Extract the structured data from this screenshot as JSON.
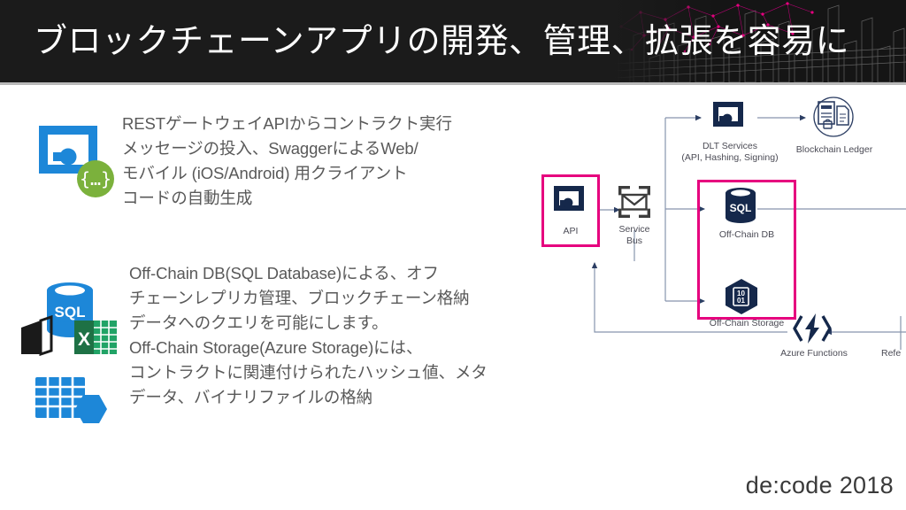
{
  "slide": {
    "title": "ブロックチェーンアプリの開発、管理、拡張を容易に",
    "footer": "de:code 2018",
    "accent_pink": "#e6007e",
    "banner_bg": "#1b1b1b",
    "body_text_color": "#595959",
    "azure_blue": "#0078d4",
    "navy": "#15284b"
  },
  "bullets": [
    {
      "id": "bullet-api",
      "icon_name": "api-apps-json-icon",
      "text": "RESTゲートウェイAPIからコントラクト実行\nメッセージの投入、SwaggerによるWeb/\nモバイル (iOS/Android) 用クライアント\nコードの自動生成"
    },
    {
      "id": "bullet-offchain",
      "icon_name": "sql-database-powerbi-excel-icon",
      "icon_name_2": "azure-table-storage-icon",
      "text": "Off-Chain DB(SQL Database)による、オフ\nチェーンレプリカ管理、ブロックチェーン格納\nデータへのクエリを可能にします。\nOff-Chain Storage(Azure Storage)には、\nコントラクトに関連付けられたハッシュ値、メタ\nデータ、バイナリファイルの格納"
    }
  ],
  "diagram": {
    "nodes": [
      {
        "id": "api",
        "label": "API",
        "icon": "api-apps-icon",
        "highlighted": true
      },
      {
        "id": "service-bus",
        "label": "Service\nBus",
        "icon": "service-bus-icon",
        "highlighted": false
      },
      {
        "id": "dlt-services",
        "label": "DLT Services\n(API, Hashing, Signing)",
        "icon": "api-apps-icon",
        "highlighted": false
      },
      {
        "id": "blockchain-ledger",
        "label": "Blockchain Ledger",
        "icon": "blockchain-ledger-icon",
        "highlighted": false
      },
      {
        "id": "off-chain-db",
        "label": "Off-Chain DB",
        "icon": "sql-database-icon",
        "highlighted": true
      },
      {
        "id": "off-chain-storage",
        "label": "Off-Chain Storage",
        "icon": "binary-storage-icon",
        "highlighted": true
      },
      {
        "id": "azure-functions",
        "label": "Azure Functions",
        "icon": "azure-functions-icon",
        "highlighted": false
      },
      {
        "id": "reference-cut",
        "label": "Refe",
        "icon": "none",
        "highlighted": false
      }
    ],
    "icon_texts": {
      "sql": "SQL",
      "binary_top": "10",
      "binary_bottom": "01"
    }
  }
}
